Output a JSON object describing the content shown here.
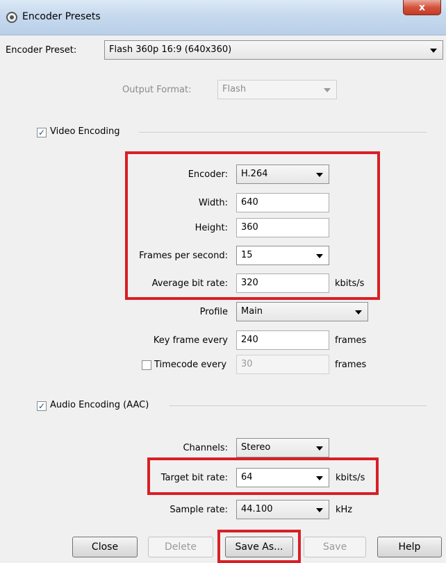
{
  "window": {
    "title": "Encoder Presets",
    "close_glyph": "x"
  },
  "preset": {
    "label": "Encoder Preset:",
    "value": "Flash 360p 16:9 (640x360)"
  },
  "output_format": {
    "label": "Output Format:",
    "value": "Flash"
  },
  "video": {
    "section_label": "Video Encoding",
    "checked": true,
    "encoder_label": "Encoder:",
    "encoder_value": "H.264",
    "width_label": "Width:",
    "width_value": "640",
    "height_label": "Height:",
    "height_value": "360",
    "fps_label": "Frames per second:",
    "fps_value": "15",
    "bitrate_label": "Average bit rate:",
    "bitrate_value": "320",
    "bitrate_unit": "kbits/s",
    "profile_label": "Profile",
    "profile_value": "Main",
    "keyframe_label": "Key frame every",
    "keyframe_value": "240",
    "keyframe_unit": "frames",
    "timecode_label": "Timecode every",
    "timecode_checked": false,
    "timecode_value": "30",
    "timecode_unit": "frames"
  },
  "audio": {
    "section_label": "Audio Encoding (AAC)",
    "checked": true,
    "channels_label": "Channels:",
    "channels_value": "Stereo",
    "target_bitrate_label": "Target bit rate:",
    "target_bitrate_value": "64",
    "target_bitrate_unit": "kbits/s",
    "sample_rate_label": "Sample rate:",
    "sample_rate_value": "44.100",
    "sample_rate_unit": "kHz"
  },
  "buttons": {
    "close": "Close",
    "delete": "Delete",
    "save_as": "Save As...",
    "save": "Save",
    "help": "Help"
  },
  "colors": {
    "highlight": "#d81f26"
  }
}
